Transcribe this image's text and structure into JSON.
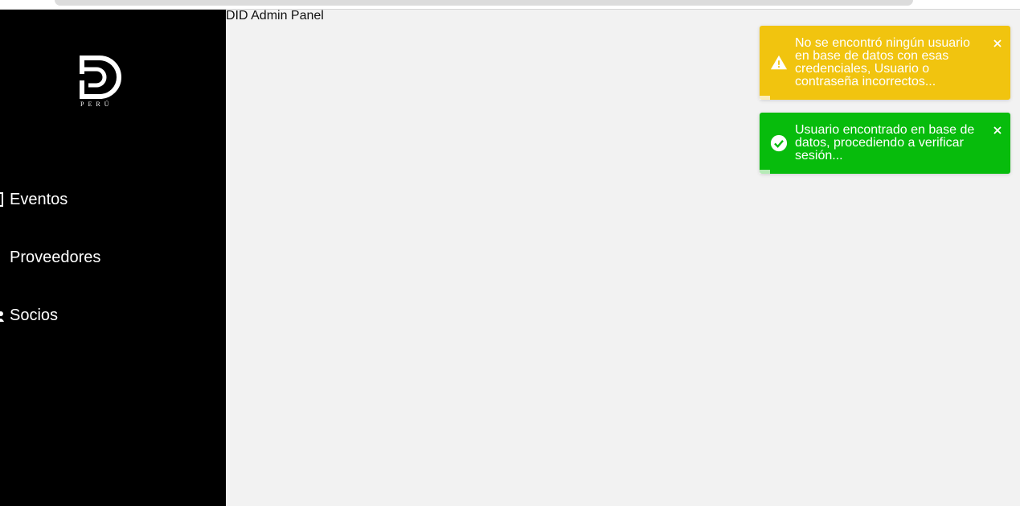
{
  "app": {
    "title": "DID Admin Panel",
    "logo_text": "PERÚ"
  },
  "sidebar": {
    "items": [
      {
        "label": "Eventos",
        "icon": "calendar-icon"
      },
      {
        "label": "Proveedores",
        "icon": "user-tie-icon"
      },
      {
        "label": "Socios",
        "icon": "users-icon"
      }
    ]
  },
  "toasts": [
    {
      "type": "warning",
      "icon": "warning-icon",
      "message": "No se encontró ningún usuario en base de datos con esas credenciales, Usuario o contraseña incorrectos...",
      "color": "#f1c40f"
    },
    {
      "type": "success",
      "icon": "check-circle-icon",
      "message": "Usuario encontrado en base de datos, procediendo a verificar sesión...",
      "color": "#07bc0c"
    }
  ],
  "colors": {
    "sidebar_bg": "#000000",
    "main_bg": "#f2f2f2",
    "warning": "#f1c40f",
    "success": "#07bc0c"
  }
}
